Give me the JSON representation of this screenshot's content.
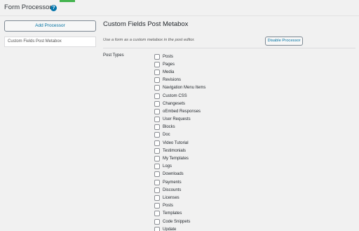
{
  "header": {
    "title": "Form Processors",
    "help_icon": "?"
  },
  "sidebar": {
    "add_button_label": "Add Processor",
    "processors": [
      {
        "label": "Custom Fields Post Metabox"
      }
    ]
  },
  "main": {
    "title": "Custom Fields Post Metabox",
    "description": "Use a form as a custom metabox in the post editor.",
    "disable_button_label": "Disable Processor",
    "post_types_label": "Post Types",
    "post_types": [
      "Posts",
      "Pages",
      "Media",
      "Revisions",
      "Navigation Menu Items",
      "Custom CSS",
      "Changesets",
      "oEmbed Responses",
      "User Requests",
      "Blocks",
      "Doc",
      "Video Tutorial",
      "Testimonials",
      "My Templates",
      "Logs",
      "Downloads",
      "Payments",
      "Discounts",
      "Licenses",
      "Posts",
      "Templates",
      "Code Snippets",
      "Update"
    ]
  },
  "colors": {
    "accent_link": "#0071a1",
    "help_badge": "#0073aa",
    "green_accent": "#46b450"
  }
}
